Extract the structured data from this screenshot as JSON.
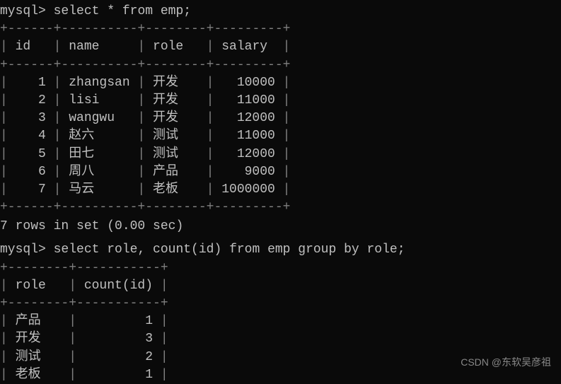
{
  "query1": {
    "prompt": "mysql>",
    "sql": "select * from emp;",
    "headers": [
      "id",
      "name",
      "role",
      "salary"
    ],
    "rows": [
      {
        "id": "1",
        "name": "zhangsan",
        "role": "开发",
        "salary": "10000"
      },
      {
        "id": "2",
        "name": "lisi",
        "role": "开发",
        "salary": "11000"
      },
      {
        "id": "3",
        "name": "wangwu",
        "role": "开发",
        "salary": "12000"
      },
      {
        "id": "4",
        "name": "赵六",
        "role": "测试",
        "salary": "11000"
      },
      {
        "id": "5",
        "name": "田七",
        "role": "测试",
        "salary": "12000"
      },
      {
        "id": "6",
        "name": "周八",
        "role": "产品",
        "salary": "9000"
      },
      {
        "id": "7",
        "name": "马云",
        "role": "老板",
        "salary": "1000000"
      }
    ],
    "sep": "+------+----------+--------+---------+",
    "status": "7 rows in set (0.00 sec)"
  },
  "query2": {
    "prompt": "mysql>",
    "sql": "select role, count(id) from emp group by role;",
    "headers": [
      "role",
      "count(id)"
    ],
    "rows": [
      {
        "role": "产品",
        "count": "1"
      },
      {
        "role": "开发",
        "count": "3"
      },
      {
        "role": "测试",
        "count": "2"
      },
      {
        "role": "老板",
        "count": "1"
      }
    ],
    "sep": "+--------+-----------+"
  },
  "watermark": "CSDN @东软吴彦祖"
}
